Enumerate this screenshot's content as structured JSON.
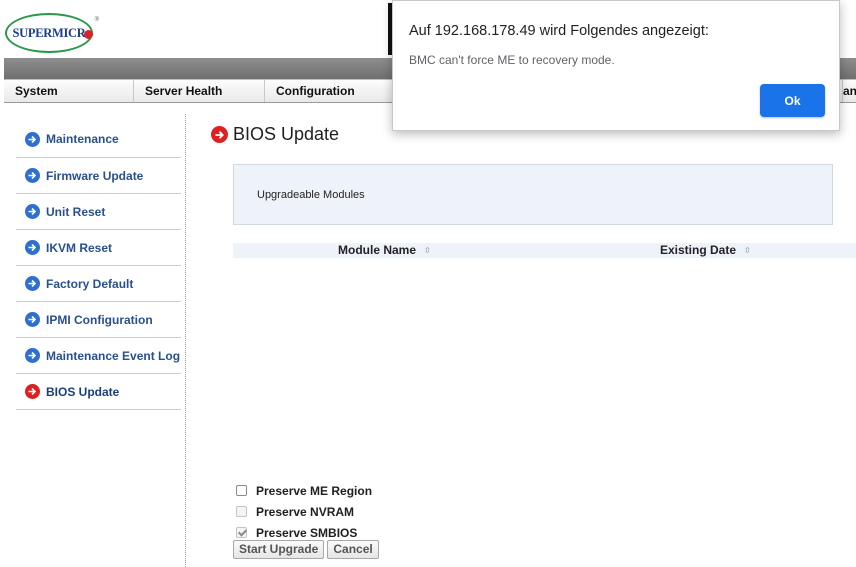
{
  "logo": {
    "text": "SUPERMICR",
    "tm": "®"
  },
  "menu": {
    "items": [
      "System",
      "Server Health",
      "Configuration",
      "anc"
    ]
  },
  "sidebar": {
    "items": [
      {
        "label": "Maintenance",
        "active": false
      },
      {
        "label": "Firmware Update",
        "active": false
      },
      {
        "label": "Unit Reset",
        "active": false
      },
      {
        "label": "IKVM Reset",
        "active": false
      },
      {
        "label": "Factory Default",
        "active": false
      },
      {
        "label": "IPMI Configuration",
        "active": false
      },
      {
        "label": "Maintenance Event Log",
        "active": false
      },
      {
        "label": "BIOS Update",
        "active": true
      }
    ]
  },
  "main": {
    "title": "BIOS Update",
    "modules_label": "Upgradeable Modules",
    "table": {
      "columns": [
        "Module Name",
        "Existing Date"
      ],
      "sort_icon": "⇳"
    },
    "options": [
      {
        "label": "Preserve ME Region",
        "checked": false,
        "disabled": false
      },
      {
        "label": "Preserve NVRAM",
        "checked": false,
        "disabled": true
      },
      {
        "label": "Preserve SMBIOS",
        "checked": true,
        "disabled": true
      }
    ],
    "buttons": {
      "start": "Start Upgrade",
      "cancel": "Cancel"
    }
  },
  "dialog": {
    "title": "Auf 192.168.178.49 wird Folgendes angezeigt:",
    "message": "BMC can't force ME to recovery mode.",
    "ok": "Ok"
  },
  "colors": {
    "arrow_blue": "#2f6fd0",
    "arrow_red": "#e02020",
    "ok_button": "#1a73e8",
    "panel_bg": "#eef3fa"
  }
}
